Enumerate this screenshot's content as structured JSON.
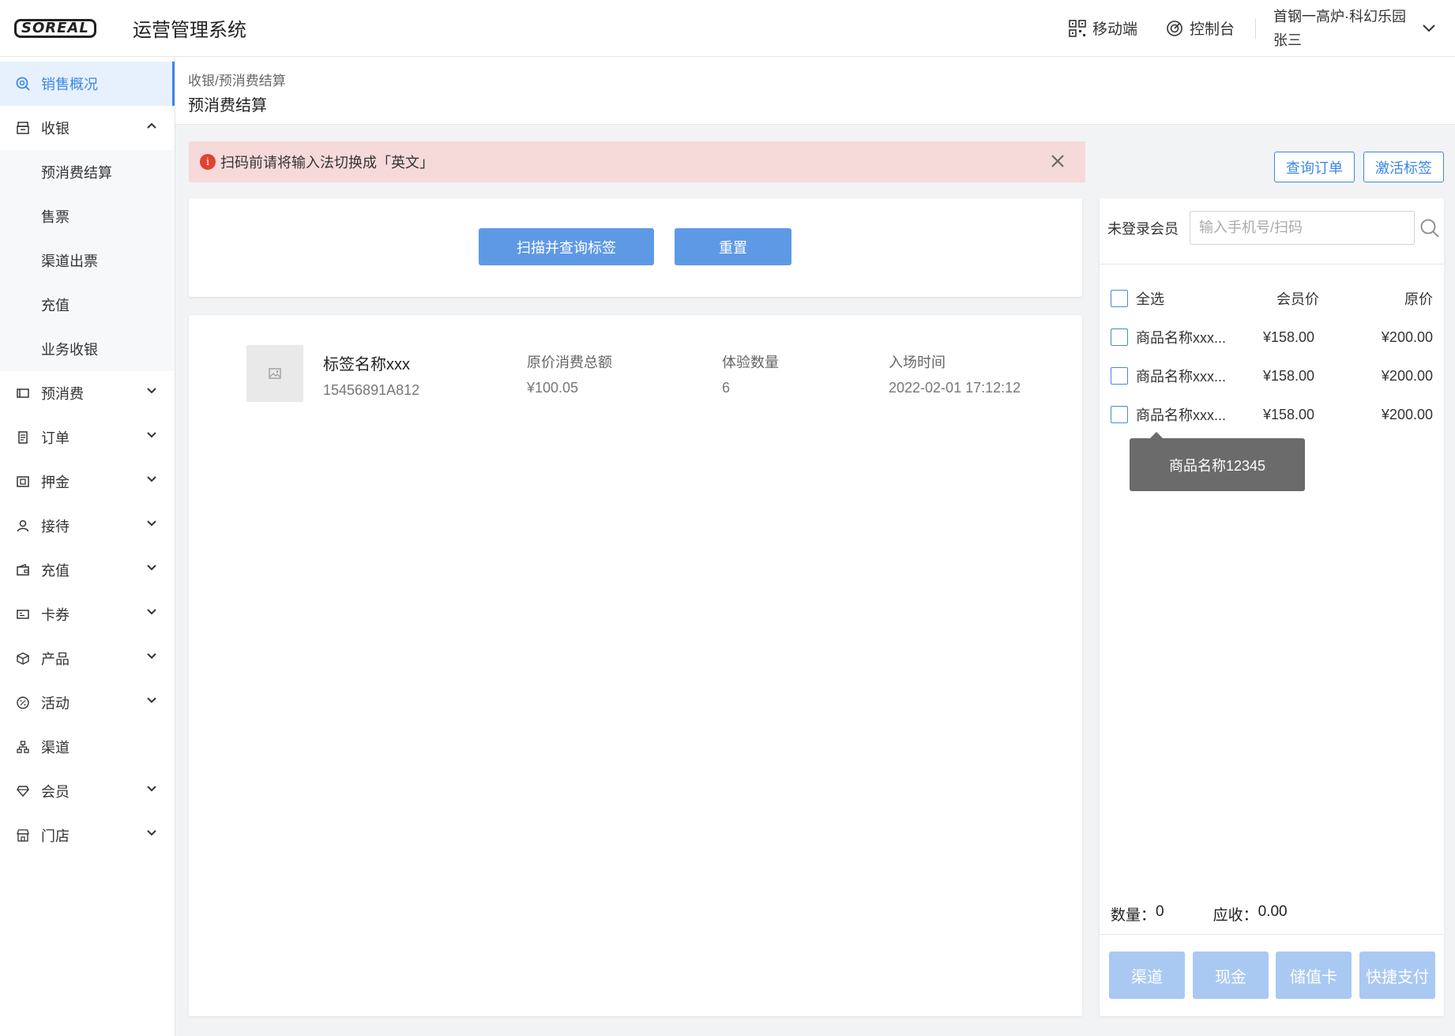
{
  "app": {
    "logo_text": "SOREAL",
    "title": "运营管理系统"
  },
  "topbar": {
    "mobile_label": "移动端",
    "console_label": "控制台",
    "org_name": "首钢一高炉·科幻乐园",
    "user_name": "张三"
  },
  "sidebar": {
    "items": [
      {
        "label": "销售概况",
        "icon": "search-circle-icon"
      },
      {
        "label": "收银",
        "icon": "cashier-icon"
      },
      {
        "label": "预消费",
        "icon": "wallet-icon"
      },
      {
        "label": "订单",
        "icon": "document-icon"
      },
      {
        "label": "押金",
        "icon": "deposit-icon"
      },
      {
        "label": "接待",
        "icon": "user-icon"
      },
      {
        "label": "充值",
        "icon": "purse-icon"
      },
      {
        "label": "卡券",
        "icon": "coupon-icon"
      },
      {
        "label": "产品",
        "icon": "box-icon"
      },
      {
        "label": "活动",
        "icon": "percent-icon"
      },
      {
        "label": "渠道",
        "icon": "channel-icon"
      },
      {
        "label": "会员",
        "icon": "diamond-icon"
      },
      {
        "label": "门店",
        "icon": "store-icon"
      }
    ],
    "sub_items": [
      "预消费结算",
      "售票",
      "渠道出票",
      "充值",
      "业务收银"
    ]
  },
  "breadcrumb": "收银/预消费结算",
  "page_title": "预消费结算",
  "alert": {
    "text": "扫码前请将输入法切换成「英文」"
  },
  "actions": {
    "query_order": "查询订单",
    "activate_tag": "激活标签",
    "scan_query": "扫描并查询标签",
    "reset": "重置"
  },
  "tag_record": {
    "name": "标签名称xxx",
    "code": "15456891A812",
    "amount_label": "原价消费总额",
    "amount_value": "¥100.05",
    "count_label": "体验数量",
    "count_value": "6",
    "time_label": "入场时间",
    "time_value": "2022-02-01 17:12:12"
  },
  "member": {
    "label": "未登录会员",
    "placeholder": "输入手机号/扫码"
  },
  "product_table": {
    "headers": {
      "select_all": "全选",
      "member_price": "会员价",
      "original_price": "原价"
    },
    "rows": [
      {
        "name": "商品名称xxx...",
        "member_price": "¥158.00",
        "original_price": "¥200.00"
      },
      {
        "name": "商品名称xxx...",
        "member_price": "¥158.00",
        "original_price": "¥200.00"
      },
      {
        "name": "商品名称xxx...",
        "member_price": "¥158.00",
        "original_price": "¥200.00"
      }
    ],
    "tooltip": "商品名称12345"
  },
  "summary": {
    "quantity_label": "数量：",
    "quantity_value": "0",
    "receivable_label": "应收：",
    "receivable_value": "0.00"
  },
  "payment": {
    "channel": "渠道",
    "cash": "现金",
    "stored_card": "储值卡",
    "quick_pay": "快捷支付"
  },
  "colors": {
    "accent": "#3c87e5",
    "primary_button": "#5e99e6",
    "disabled_button": "#a9c9f3",
    "alert_bg": "#f6dada",
    "alert_icon": "#e0432f"
  }
}
